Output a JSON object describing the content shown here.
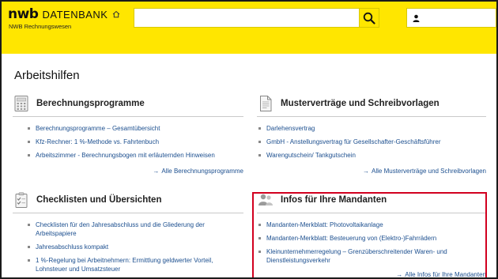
{
  "header": {
    "logo_main": "nwb",
    "logo_sub": "DATENBANK",
    "subbrand": "NWB Rechnungswesen",
    "search": {
      "value": "",
      "placeholder": ""
    }
  },
  "main": {
    "title": "Arbeitshilfen",
    "cards": [
      {
        "title": "Berechnungsprogramme",
        "icon": "calculator-icon",
        "items": [
          "Berechnungsprogramme – Gesamtübersicht",
          "Kfz-Rechner: 1 %-Methode vs. Fahrtenbuch",
          "Arbeitszimmer - Berechnungsbogen mit erläuternden Hinweisen"
        ],
        "all_link": "Alle Berechnungsprogramme"
      },
      {
        "title": "Musterverträge und Schreibvorlagen",
        "icon": "document-icon",
        "items": [
          "Darlehensvertrag",
          "GmbH - Anstellungsvertrag für Gesellschafter-Geschäftsführer",
          "Warengutschein/ Tankgutschein"
        ],
        "all_link": "Alle Musterverträge und Schreibvorlagen"
      },
      {
        "title": "Checklisten und Übersichten",
        "icon": "checklist-icon",
        "items": [
          "Checklisten für den Jahresabschluss und die Gliederung der Arbeitspapiere",
          "Jahresabschluss kompakt",
          "1 %-Regelung bei Arbeitnehmern: Ermittlung geldwerter Vorteil, Lohnsteuer und Umsatzsteuer"
        ],
        "all_link": ""
      },
      {
        "title": "Infos für Ihre Mandanten",
        "icon": "people-icon",
        "items": [
          "Mandanten-Merkblatt: Photovoltaikanlage",
          "Mandanten-Merkblatt: Besteuerung von (Elektro-)Fahrrädern",
          "Kleinunternehmerregelung – Grenzüberschreitender Waren- und Dienstleistungsverkehr"
        ],
        "all_link": "Alle Infos für Ihre Mandanten"
      }
    ]
  },
  "colors": {
    "brand_yellow": "#ffe600",
    "link_blue": "#1c4f8f",
    "highlight_red": "#d2001f"
  }
}
